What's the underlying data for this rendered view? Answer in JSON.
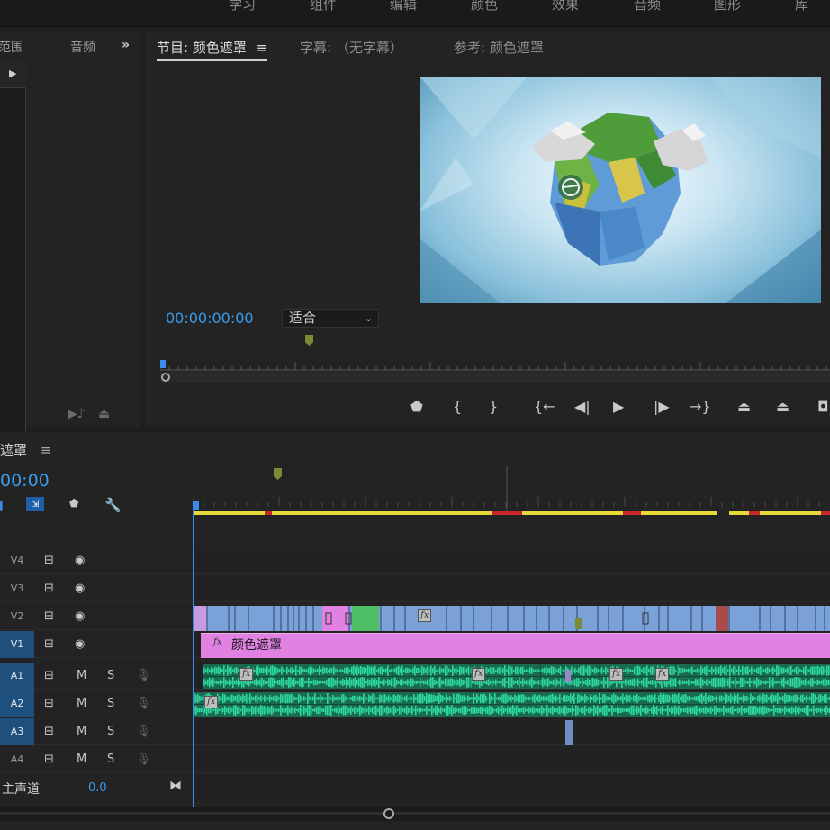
{
  "workspace_tabs": [
    "学习",
    "组件",
    "编辑",
    "颜色",
    "效果",
    "音频",
    "图形",
    "库"
  ],
  "left_panel": {
    "tabs": [
      "范围",
      "音频"
    ],
    "overflow": "»"
  },
  "monitor": {
    "tabs": [
      {
        "label": "节目: 颜色遮罩",
        "active": true
      },
      {
        "label": "字幕: （无字幕）",
        "active": false
      },
      {
        "label": "参考: 颜色遮罩",
        "active": false
      }
    ],
    "menu_icon": "≡",
    "timecode": "00:00:00:00",
    "zoom": "适合",
    "controls": [
      "marker-icon",
      "mark-in-icon",
      "mark-out-icon",
      "go-to-in-icon",
      "step-back-icon",
      "play-icon",
      "step-forward-icon",
      "go-to-out-icon",
      "lift-icon",
      "extract-icon",
      "export-frame-icon"
    ]
  },
  "timeline": {
    "title": "遮罩",
    "menu_icon": "≡",
    "timecode": "00:00",
    "tools": [
      "snap-icon",
      "linked-selection-icon",
      "add-marker-icon",
      "settings-icon"
    ],
    "video_tracks": [
      {
        "name": "V4",
        "selected": false
      },
      {
        "name": "V3",
        "selected": false
      },
      {
        "name": "V2",
        "selected": false
      },
      {
        "name": "V1",
        "selected": true
      }
    ],
    "audio_tracks": [
      {
        "name": "A1",
        "m": "M",
        "s": "S"
      },
      {
        "name": "A2",
        "m": "M",
        "s": "S"
      },
      {
        "name": "A3",
        "m": "M",
        "s": "S"
      },
      {
        "name": "A4",
        "m": "M",
        "s": "S"
      }
    ],
    "master": {
      "label": "主声道",
      "value": "0.0"
    },
    "v1_clip_label": "颜色遮罩",
    "fx_badge": "fx"
  },
  "colors": {
    "accent_blue": "#3a9bec",
    "video_clip": "#7aa1d8",
    "color_matte_clip": "#e181e1",
    "audio_clip": "#1a6a52",
    "render_yellow": "#e8d93a",
    "render_red": "#c8282b"
  }
}
